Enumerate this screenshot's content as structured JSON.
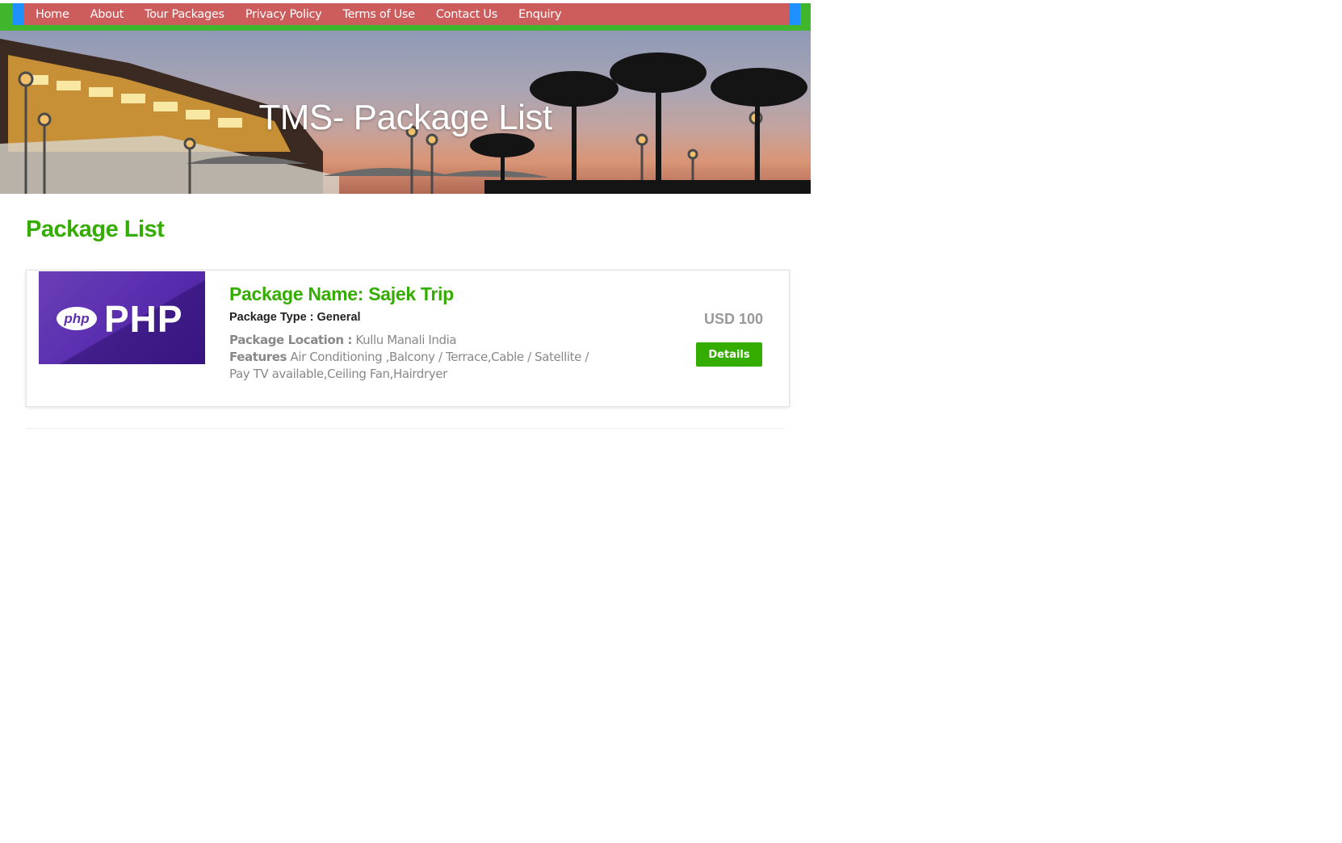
{
  "nav": {
    "items": [
      {
        "label": "Home"
      },
      {
        "label": "About"
      },
      {
        "label": "Tour Packages"
      },
      {
        "label": "Privacy Policy"
      },
      {
        "label": "Terms of Use"
      },
      {
        "label": "Contact Us"
      },
      {
        "label": "Enquiry"
      }
    ]
  },
  "banner": {
    "title": "TMS- Package List"
  },
  "main": {
    "heading": "Package List",
    "packages": [
      {
        "image_text": {
          "badge": "php",
          "word": "PHP"
        },
        "name": "Package Name: Sajek Trip",
        "type": "Package Type : General",
        "location_label": "Package Location :",
        "location": "Kullu Manali India",
        "features_label": "Features",
        "features": "Air Conditioning ,Balcony / Terrace,Cable / Satellite / Pay TV available,Ceiling Fan,Hairdryer",
        "price": "USD 100",
        "details_label": "Details"
      }
    ]
  },
  "colors": {
    "brand_green": "#34ad00",
    "nav_red": "#cd5c5c",
    "nav_blue": "#1e90ff",
    "php_purple": "#5b2fb0"
  }
}
